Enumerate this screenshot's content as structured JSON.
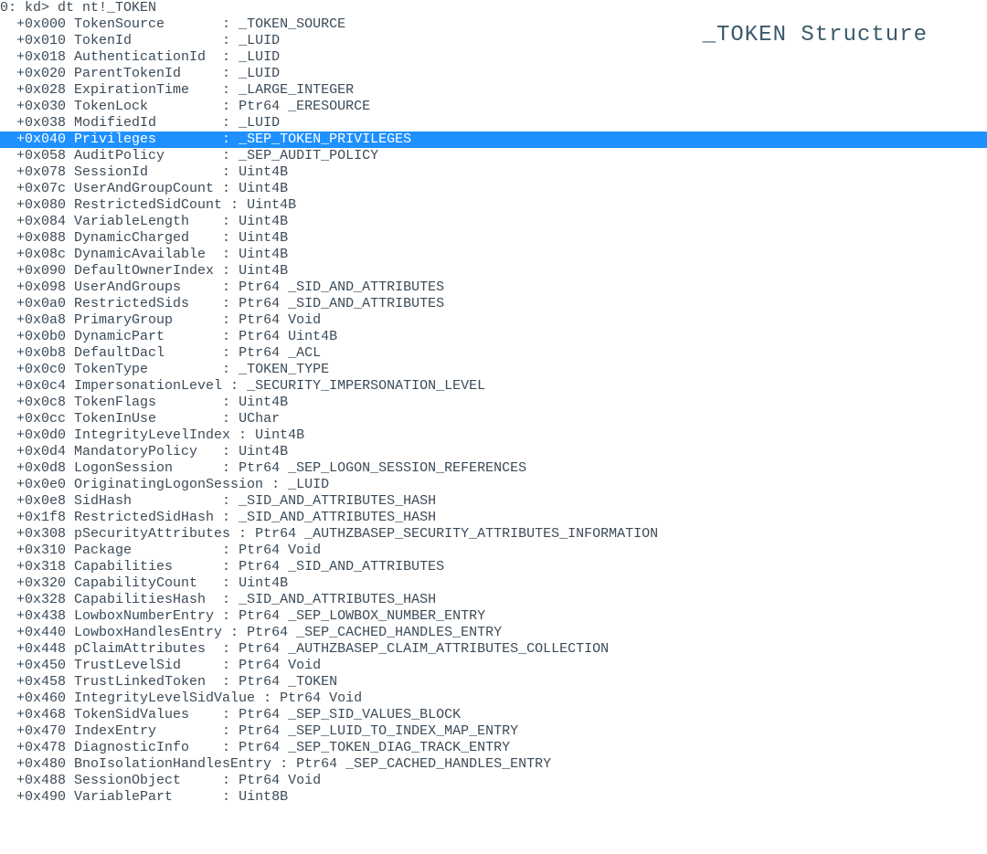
{
  "title": "_TOKEN Structure",
  "prompt_prefix": "0:",
  "prompt": " kd> ",
  "command": "dt nt!_TOKEN",
  "highlight_offset": "+0x040",
  "fields": [
    {
      "offset": "+0x000",
      "name": "TokenSource",
      "type": "_TOKEN_SOURCE"
    },
    {
      "offset": "+0x010",
      "name": "TokenId",
      "type": "_LUID"
    },
    {
      "offset": "+0x018",
      "name": "AuthenticationId",
      "type": "_LUID"
    },
    {
      "offset": "+0x020",
      "name": "ParentTokenId",
      "type": "_LUID"
    },
    {
      "offset": "+0x028",
      "name": "ExpirationTime",
      "type": "_LARGE_INTEGER"
    },
    {
      "offset": "+0x030",
      "name": "TokenLock",
      "type": "Ptr64 _ERESOURCE"
    },
    {
      "offset": "+0x038",
      "name": "ModifiedId",
      "type": "_LUID"
    },
    {
      "offset": "+0x040",
      "name": "Privileges",
      "type": "_SEP_TOKEN_PRIVILEGES"
    },
    {
      "offset": "+0x058",
      "name": "AuditPolicy",
      "type": "_SEP_AUDIT_POLICY"
    },
    {
      "offset": "+0x078",
      "name": "SessionId",
      "type": "Uint4B"
    },
    {
      "offset": "+0x07c",
      "name": "UserAndGroupCount",
      "type": "Uint4B"
    },
    {
      "offset": "+0x080",
      "name": "RestrictedSidCount",
      "type": "Uint4B"
    },
    {
      "offset": "+0x084",
      "name": "VariableLength",
      "type": "Uint4B"
    },
    {
      "offset": "+0x088",
      "name": "DynamicCharged",
      "type": "Uint4B"
    },
    {
      "offset": "+0x08c",
      "name": "DynamicAvailable",
      "type": "Uint4B"
    },
    {
      "offset": "+0x090",
      "name": "DefaultOwnerIndex",
      "type": "Uint4B"
    },
    {
      "offset": "+0x098",
      "name": "UserAndGroups",
      "type": "Ptr64 _SID_AND_ATTRIBUTES"
    },
    {
      "offset": "+0x0a0",
      "name": "RestrictedSids",
      "type": "Ptr64 _SID_AND_ATTRIBUTES"
    },
    {
      "offset": "+0x0a8",
      "name": "PrimaryGroup",
      "type": "Ptr64 Void"
    },
    {
      "offset": "+0x0b0",
      "name": "DynamicPart",
      "type": "Ptr64 Uint4B"
    },
    {
      "offset": "+0x0b8",
      "name": "DefaultDacl",
      "type": "Ptr64 _ACL"
    },
    {
      "offset": "+0x0c0",
      "name": "TokenType",
      "type": "_TOKEN_TYPE"
    },
    {
      "offset": "+0x0c4",
      "name": "ImpersonationLevel",
      "type": "_SECURITY_IMPERSONATION_LEVEL"
    },
    {
      "offset": "+0x0c8",
      "name": "TokenFlags",
      "type": "Uint4B"
    },
    {
      "offset": "+0x0cc",
      "name": "TokenInUse",
      "type": "UChar"
    },
    {
      "offset": "+0x0d0",
      "name": "IntegrityLevelIndex",
      "type": "Uint4B"
    },
    {
      "offset": "+0x0d4",
      "name": "MandatoryPolicy",
      "type": "Uint4B"
    },
    {
      "offset": "+0x0d8",
      "name": "LogonSession",
      "type": "Ptr64 _SEP_LOGON_SESSION_REFERENCES"
    },
    {
      "offset": "+0x0e0",
      "name": "OriginatingLogonSession",
      "type": "_LUID"
    },
    {
      "offset": "+0x0e8",
      "name": "SidHash",
      "type": "_SID_AND_ATTRIBUTES_HASH"
    },
    {
      "offset": "+0x1f8",
      "name": "RestrictedSidHash",
      "type": "_SID_AND_ATTRIBUTES_HASH"
    },
    {
      "offset": "+0x308",
      "name": "pSecurityAttributes",
      "type": "Ptr64 _AUTHZBASEP_SECURITY_ATTRIBUTES_INFORMATION"
    },
    {
      "offset": "+0x310",
      "name": "Package",
      "type": "Ptr64 Void"
    },
    {
      "offset": "+0x318",
      "name": "Capabilities",
      "type": "Ptr64 _SID_AND_ATTRIBUTES"
    },
    {
      "offset": "+0x320",
      "name": "CapabilityCount",
      "type": "Uint4B"
    },
    {
      "offset": "+0x328",
      "name": "CapabilitiesHash",
      "type": "_SID_AND_ATTRIBUTES_HASH"
    },
    {
      "offset": "+0x438",
      "name": "LowboxNumberEntry",
      "type": "Ptr64 _SEP_LOWBOX_NUMBER_ENTRY"
    },
    {
      "offset": "+0x440",
      "name": "LowboxHandlesEntry",
      "type": "Ptr64 _SEP_CACHED_HANDLES_ENTRY"
    },
    {
      "offset": "+0x448",
      "name": "pClaimAttributes",
      "type": "Ptr64 _AUTHZBASEP_CLAIM_ATTRIBUTES_COLLECTION"
    },
    {
      "offset": "+0x450",
      "name": "TrustLevelSid",
      "type": "Ptr64 Void"
    },
    {
      "offset": "+0x458",
      "name": "TrustLinkedToken",
      "type": "Ptr64 _TOKEN"
    },
    {
      "offset": "+0x460",
      "name": "IntegrityLevelSidValue",
      "type": "Ptr64 Void"
    },
    {
      "offset": "+0x468",
      "name": "TokenSidValues",
      "type": "Ptr64 _SEP_SID_VALUES_BLOCK"
    },
    {
      "offset": "+0x470",
      "name": "IndexEntry",
      "type": "Ptr64 _SEP_LUID_TO_INDEX_MAP_ENTRY"
    },
    {
      "offset": "+0x478",
      "name": "DiagnosticInfo",
      "type": "Ptr64 _SEP_TOKEN_DIAG_TRACK_ENTRY"
    },
    {
      "offset": "+0x480",
      "name": "BnoIsolationHandlesEntry",
      "type": "Ptr64 _SEP_CACHED_HANDLES_ENTRY"
    },
    {
      "offset": "+0x488",
      "name": "SessionObject",
      "type": "Ptr64 Void"
    },
    {
      "offset": "+0x490",
      "name": "VariablePart",
      "type": "Uint8B"
    }
  ]
}
